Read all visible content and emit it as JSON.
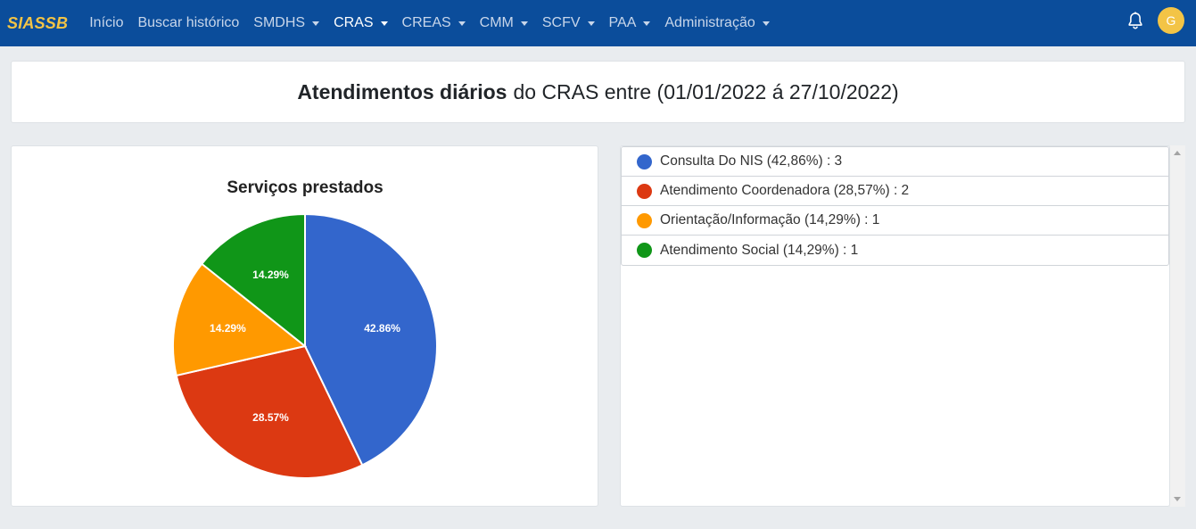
{
  "navbar": {
    "brand": "SIASSB",
    "items": [
      {
        "label": "Início",
        "caret": false,
        "active": false
      },
      {
        "label": "Buscar histórico",
        "caret": false,
        "active": false
      },
      {
        "label": "SMDHS",
        "caret": true,
        "active": false
      },
      {
        "label": "CRAS",
        "caret": true,
        "active": true
      },
      {
        "label": "CREAS",
        "caret": true,
        "active": false
      },
      {
        "label": "CMM",
        "caret": true,
        "active": false
      },
      {
        "label": "SCFV",
        "caret": true,
        "active": false
      },
      {
        "label": "PAA",
        "caret": true,
        "active": false
      },
      {
        "label": "Administração",
        "caret": true,
        "active": false
      }
    ],
    "bell_icon": "bell-icon",
    "avatar_initial": "G"
  },
  "header": {
    "title_bold": "Atendimentos diários",
    "title_rest": "do CRAS entre (01/01/2022 á 27/10/2022)"
  },
  "chart_data": {
    "type": "pie",
    "title": "Serviços prestados",
    "categories": [
      "Consulta Do NIS",
      "Atendimento Coordenadora",
      "Orientação/Informação",
      "Atendimento Social"
    ],
    "values": [
      3,
      2,
      1,
      1
    ],
    "slice_labels": [
      "42.86%",
      "28.57%",
      "14.29%",
      "14.29%"
    ],
    "colors": [
      "#3366cc",
      "#dc3912",
      "#ff9900",
      "#109618"
    ]
  },
  "legend": {
    "items": [
      {
        "label": "Consulta Do NIS (42,86%) : 3",
        "color": "#3366cc"
      },
      {
        "label": "Atendimento Coordenadora (28,57%) : 2",
        "color": "#dc3912"
      },
      {
        "label": "Orientação/Informação (14,29%) : 1",
        "color": "#ff9900"
      },
      {
        "label": "Atendimento Social (14,29%) : 1",
        "color": "#109618"
      }
    ]
  },
  "colors": {
    "navbar": "#0b4d9b",
    "brand": "#f3c446",
    "background": "#e9ecef"
  }
}
